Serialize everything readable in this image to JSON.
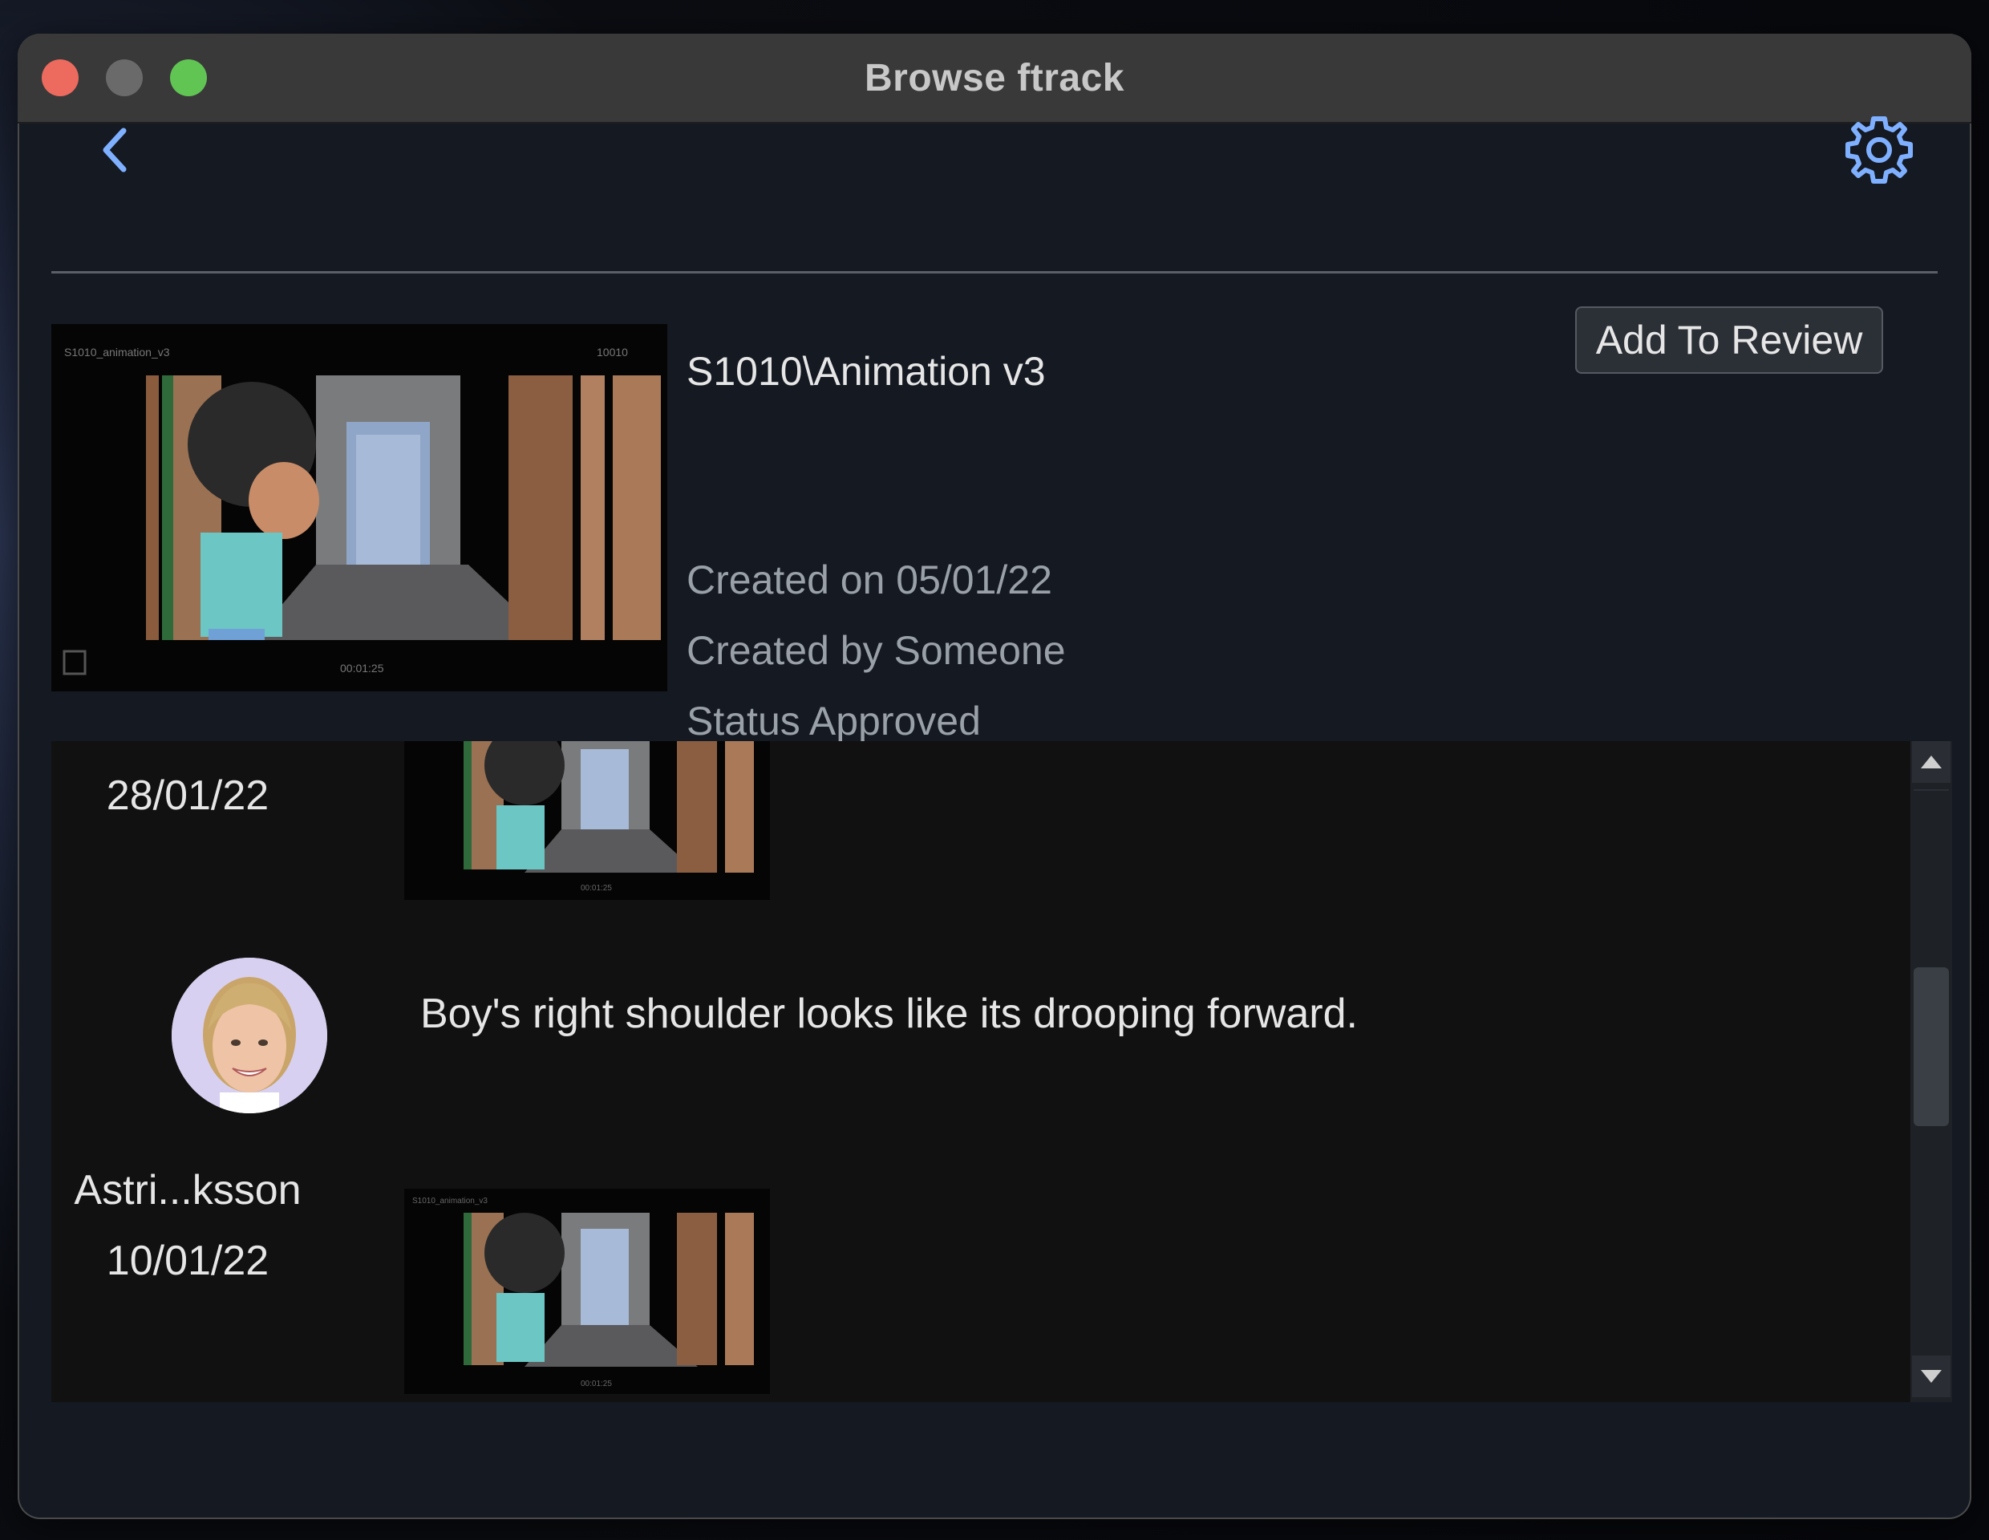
{
  "window": {
    "title": "Browse ftrack"
  },
  "toolbar": {
    "back_icon": "chevron-left-icon",
    "settings_icon": "gear-icon"
  },
  "version": {
    "name": "S1010\\Animation v3",
    "add_to_review_label": "Add To Review",
    "created_on": "Created on 05/01/22",
    "created_by": "Created by Someone",
    "status": "Status Approved"
  },
  "notes": [
    {
      "date": "28/01/22"
    },
    {
      "author": "Astri...ksson",
      "date": "10/01/22",
      "text": "Boy's right shoulder looks like its drooping forward."
    }
  ],
  "colors": {
    "accent": "#7fb0ff",
    "close": "#ed6a5e",
    "maximize": "#61c554"
  }
}
